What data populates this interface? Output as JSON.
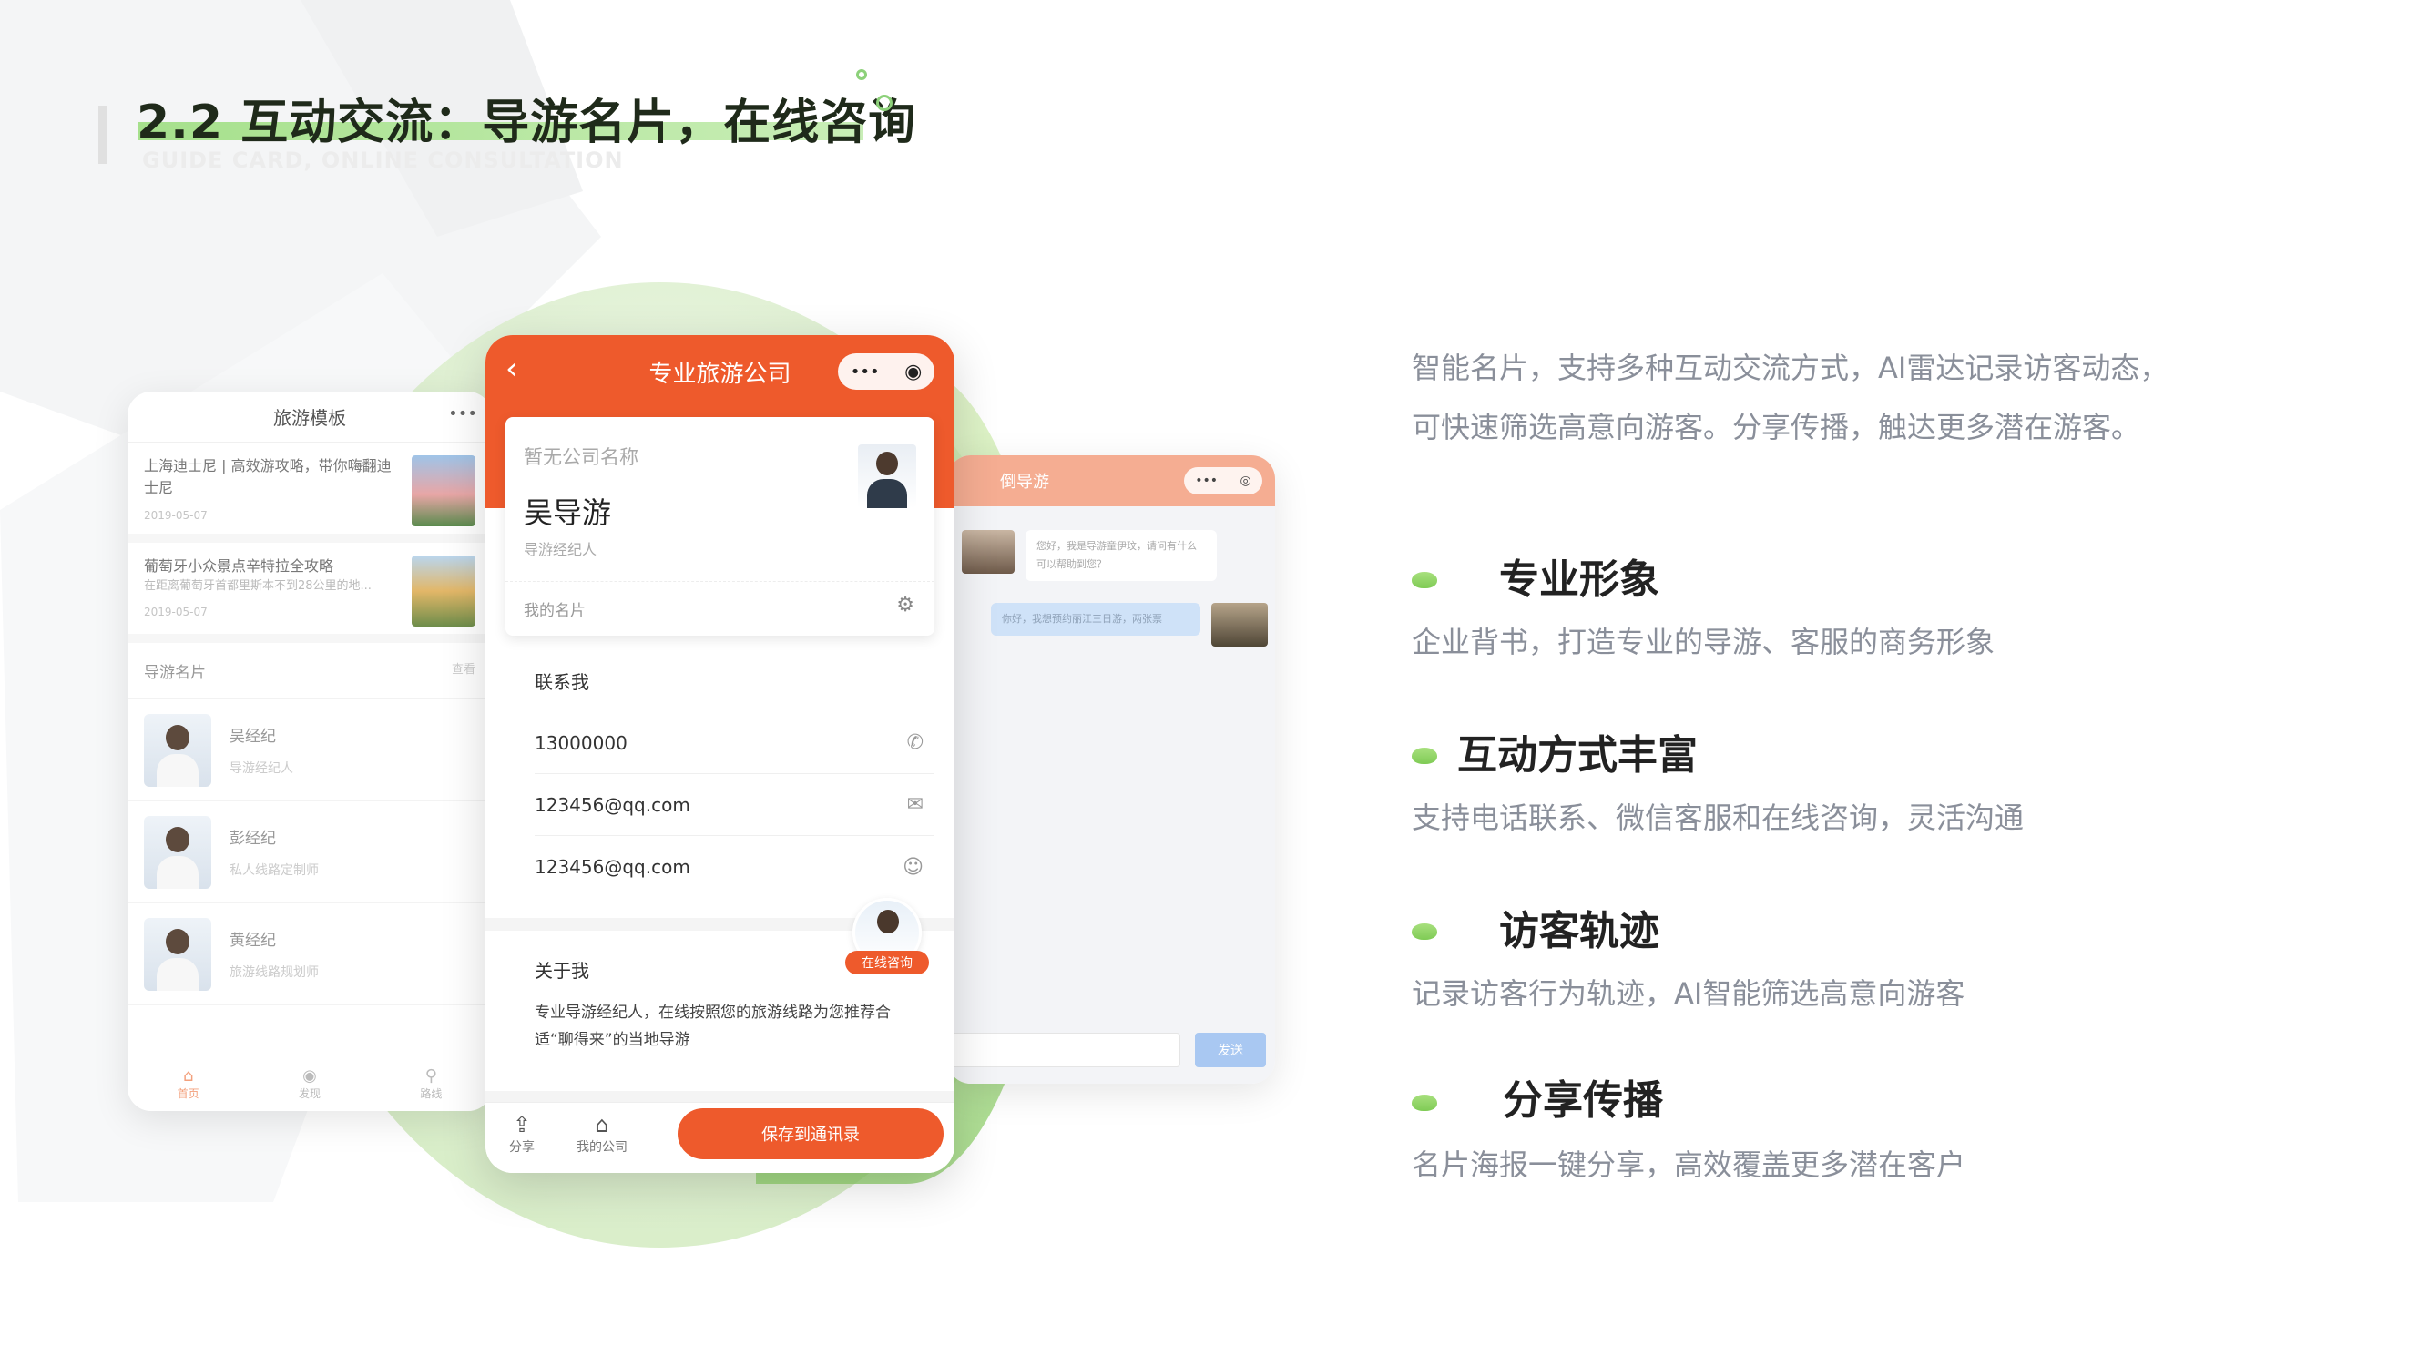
{
  "header": {
    "title": "2.2 互动交流：导游名片，在线咨询",
    "subtitle": "GUIDE CARD, ONLINE CONSULTATION"
  },
  "left_phone": {
    "title": "旅游模板",
    "menu_icon": "more-dots-icon",
    "articles": [
      {
        "title": "上海迪士尼 | 高效游攻略，带你嗨翻迪士尼",
        "date": "2019-05-07"
      },
      {
        "title": "葡萄牙小众景点辛特拉全攻略",
        "summary": "在距离葡萄牙首都里斯本不到28公里的地...",
        "date": "2019-05-07"
      }
    ],
    "section_label": "导游名片",
    "section_more": "查看",
    "guides": [
      {
        "name": "吴经纪",
        "role": "导游经纪人"
      },
      {
        "name": "彭经纪",
        "role": "私人线路定制师"
      },
      {
        "name": "黄经纪",
        "role": "旅游线路规划师"
      }
    ],
    "tabs": [
      {
        "label": "首页",
        "icon": "home-icon"
      },
      {
        "label": "发现",
        "icon": "eye-icon"
      },
      {
        "label": "路线",
        "icon": "location-pin-icon"
      }
    ]
  },
  "right_phone": {
    "title": "倒导游",
    "messages": [
      {
        "from": "guide",
        "text": "您好，我是导游童伊玟，请问有什么可以帮助到您？"
      },
      {
        "from": "visitor",
        "text": "你好，我想预约丽江三日游，两张票"
      }
    ],
    "send_label": "发送"
  },
  "main_phone": {
    "nav_title": "专业旅游公司",
    "capsule_more": "•••",
    "card": {
      "company": "暂无公司名称",
      "name": "吴导游",
      "role": "导游经纪人",
      "my_card_label": "我的名片"
    },
    "contact_label": "联系我",
    "contacts": [
      {
        "value": "13000000",
        "icon": "phone-icon"
      },
      {
        "value": "123456@qq.com",
        "icon": "mail-icon"
      },
      {
        "value": "123456@qq.com",
        "icon": "wechat-icon"
      }
    ],
    "consult_tag": "在线咨询",
    "about_label": "关于我",
    "about_text": "专业导游经纪人，在线按照您的旅游线路为您推荐合适“聊得来”的当地导游",
    "bottom": {
      "share_label": "分享",
      "company_label": "我的公司",
      "save_label": "保存到通讯录"
    }
  },
  "intro": {
    "line1": "智能名片，支持多种互动交流方式，AI雷达记录访客动态，",
    "line2": "可快速筛选高意向游客。分享传播，触达更多潜在游客。"
  },
  "features": [
    {
      "title": "专业形象",
      "desc": "企业背书，打造专业的导游、客服的商务形象"
    },
    {
      "title": "互动方式丰富",
      "desc": "支持电话联系、微信客服和在线咨询，灵活沟通"
    },
    {
      "title": "访客轨迹",
      "desc": "记录访客行为轨迹，AI智能筛选高意向游客"
    },
    {
      "title": "分享传播",
      "desc": "名片海报一键分享，高效覆盖更多潜在客户"
    }
  ],
  "colors": {
    "brand_orange": "#ee5a2c",
    "accent_green": "#8dd17a",
    "title_underline": "#a6e08c",
    "body_gray": "#8a8f9a"
  }
}
